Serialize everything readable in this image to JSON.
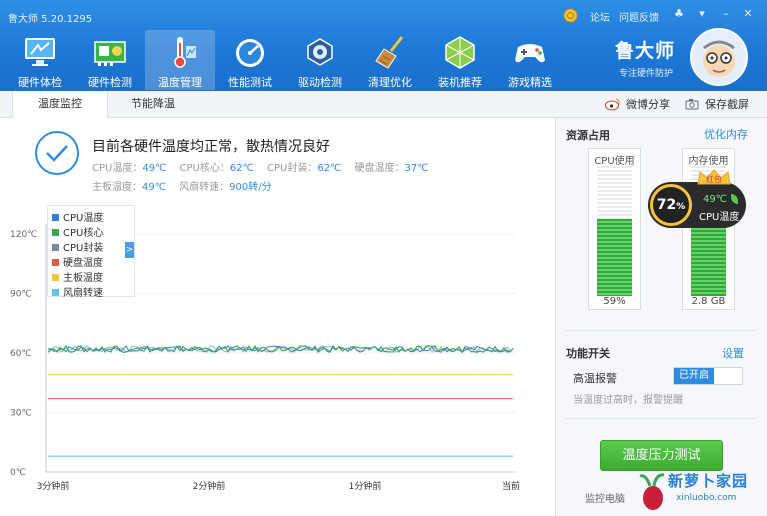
{
  "window": {
    "title": "鲁大师 5.20.1295",
    "forum_label": "论坛",
    "feedback_label": "问题反馈"
  },
  "toolbar": [
    {
      "label": "硬件体检",
      "icon": "monitor-icon"
    },
    {
      "label": "硬件检测",
      "icon": "hardware-card-icon"
    },
    {
      "label": "温度管理",
      "icon": "thermometer-icon"
    },
    {
      "label": "性能测试",
      "icon": "speedometer-icon"
    },
    {
      "label": "驱动检测",
      "icon": "gear-drive-icon"
    },
    {
      "label": "清理优化",
      "icon": "broom-icon"
    },
    {
      "label": "装机推荐",
      "icon": "cube-icon"
    },
    {
      "label": "游戏精选",
      "icon": "gamepad-icon"
    }
  ],
  "brand": {
    "name": "鲁大师",
    "slogan": "专注硬件防护"
  },
  "subtabs": [
    "温度监控",
    "节能降温"
  ],
  "subactions": {
    "share": "微博分享",
    "screenshot": "保存截屏"
  },
  "status": {
    "headline": "目前各硬件温度均正常，散热情况良好",
    "row1": [
      {
        "label": "CPU温度：",
        "value": "49℃"
      },
      {
        "label": "CPU核心：",
        "value": "62℃"
      },
      {
        "label": "CPU封装：",
        "value": "62℃"
      },
      {
        "label": "硬盘温度：",
        "value": "37℃"
      }
    ],
    "row2": [
      {
        "label": "主板温度：",
        "value": "49℃"
      },
      {
        "label": "风扇转速：",
        "value": "900转/分"
      }
    ]
  },
  "chart_data": {
    "type": "line",
    "x": [
      "3分钟前",
      "2分钟前",
      "1分钟前",
      "当前"
    ],
    "y_ticks": [
      "0℃",
      "30℃",
      "60℃",
      "90℃",
      "120℃"
    ],
    "ylim": [
      0,
      120
    ],
    "legend_toggle": ">",
    "series": [
      {
        "name": "CPU温度",
        "color": "#2e7fd8",
        "approx_value": 62
      },
      {
        "name": "CPU核心",
        "color": "#3aa655",
        "approx_value": 62
      },
      {
        "name": "CPU封装",
        "color": "#7a8b99",
        "approx_value": 62
      },
      {
        "name": "硬盘温度",
        "color": "#e05a4a",
        "approx_value": 37
      },
      {
        "name": "主板温度",
        "color": "#f0c540",
        "approx_value": 49
      },
      {
        "name": "风扇转速",
        "color": "#5bc8e8",
        "approx_value": 8
      }
    ]
  },
  "resources": {
    "title": "资源占用",
    "optimize_label": "优化内存",
    "cpu": {
      "title": "CPU使用",
      "value_label": "59%",
      "fill": 0.59
    },
    "mem": {
      "title": "内存使用",
      "value_label": "2.8 GB",
      "fill": 0.6
    },
    "badge": {
      "percent": "72",
      "percent_unit": "%",
      "temp": "49℃",
      "label": "CPU温度",
      "crown_text": "红包"
    }
  },
  "functions": {
    "title": "功能开关",
    "settings_label": "设置",
    "alarm_label": "高温报警",
    "alarm_state": "已开启",
    "alarm_desc": "当温度过高时，报警提醒"
  },
  "test_button": "温度压力测试",
  "monitor_label": "监控电脑",
  "watermark": {
    "title": "新萝卜家园",
    "url": "xinluobo.com"
  }
}
